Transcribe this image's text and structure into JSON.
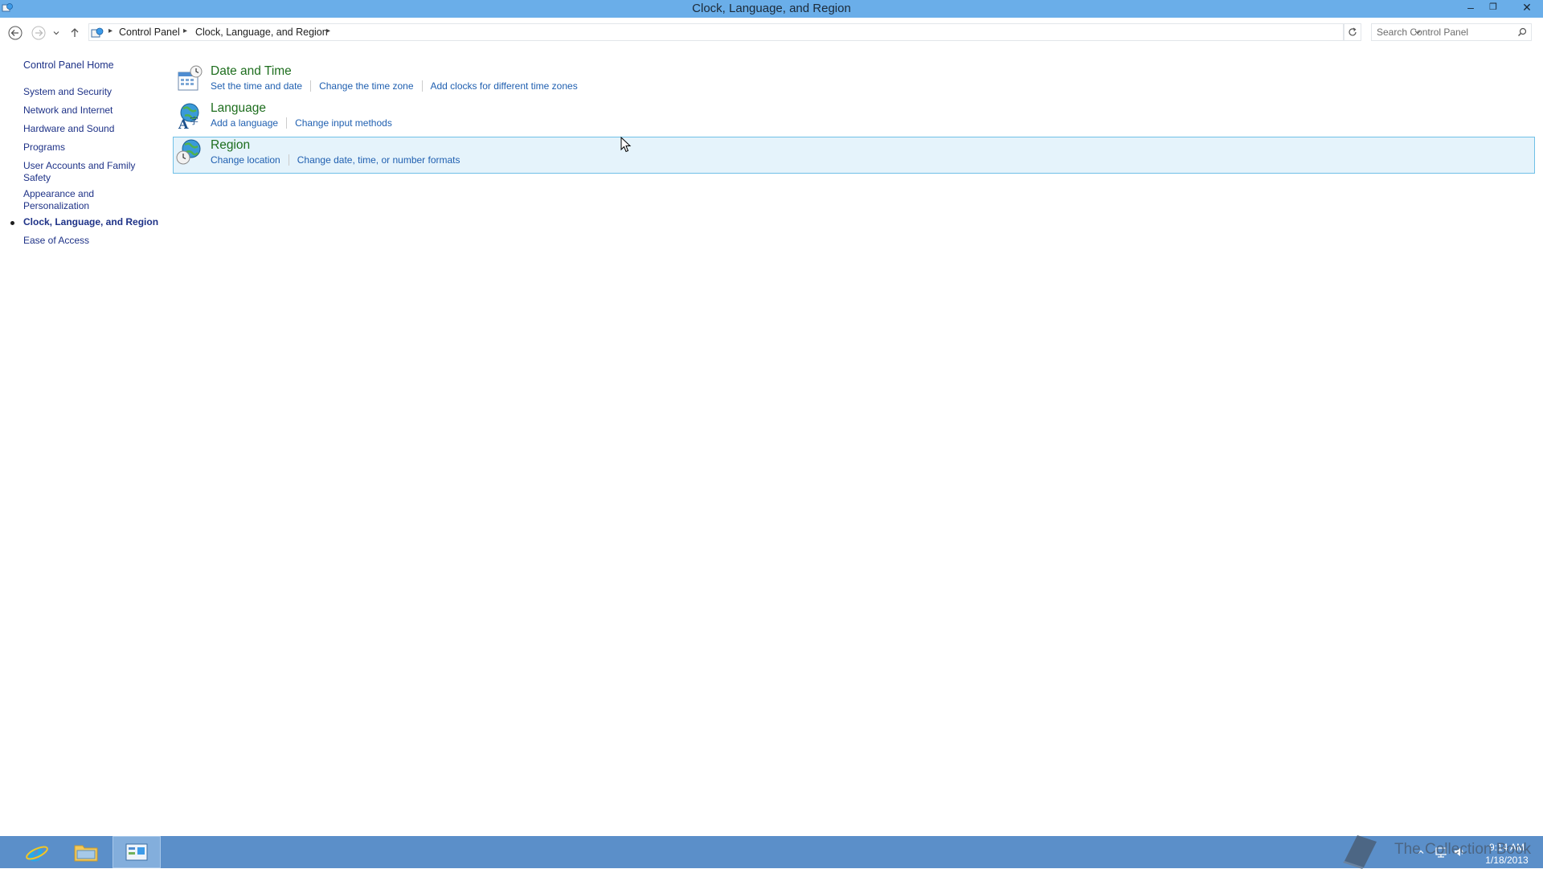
{
  "window": {
    "title": "Clock, Language, and Region",
    "min_glyph": "‒",
    "max_glyph": "❐",
    "close_glyph": "✕"
  },
  "address": {
    "crumbs": [
      "Control Panel",
      "Clock, Language, and Region"
    ],
    "search_placeholder": "Search Control Panel"
  },
  "sidebar": {
    "home": "Control Panel Home",
    "items": [
      {
        "label": "System and Security"
      },
      {
        "label": "Network and Internet"
      },
      {
        "label": "Hardware and Sound"
      },
      {
        "label": "Programs"
      },
      {
        "label": "User Accounts and Family Safety"
      },
      {
        "label": "Appearance and Personalization"
      },
      {
        "label": "Clock, Language, and Region",
        "current": true
      },
      {
        "label": "Ease of Access"
      }
    ]
  },
  "categories": [
    {
      "title": "Date and Time",
      "icon": "calendar-clock-icon",
      "links": [
        "Set the time and date",
        "Change the time zone",
        "Add clocks for different time zones"
      ]
    },
    {
      "title": "Language",
      "icon": "language-globe-icon",
      "links": [
        "Add a language",
        "Change input methods"
      ]
    },
    {
      "title": "Region",
      "icon": "region-globe-icon",
      "links": [
        "Change location",
        "Change date, time, or number formats"
      ]
    }
  ],
  "taskbar": {
    "clock_time": "9:14 AM",
    "clock_date": "1/18/2013",
    "watermark": "The Collection Book"
  },
  "colors": {
    "titlebar": "#6aaee9",
    "taskbar": "#5b8fc9",
    "link": "#1f5fb0",
    "category_title": "#1e6e1e",
    "nav_link": "#1e3287",
    "hover_bg": "#e5f3fb",
    "hover_border": "#70c0e7"
  }
}
